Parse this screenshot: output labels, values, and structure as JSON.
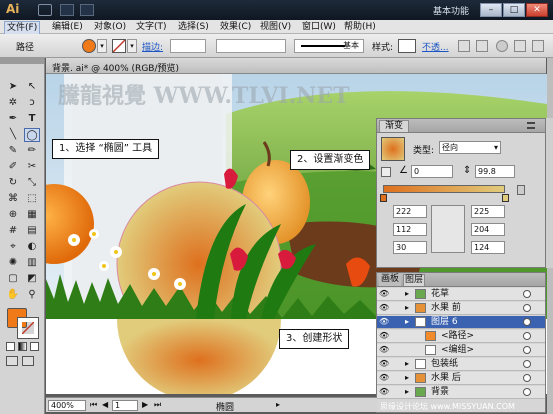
{
  "titlebar": {
    "app_logo": "Ai",
    "workspace": "基本功能",
    "buttons": [
      "–",
      "□",
      "✕"
    ]
  },
  "menubar": {
    "items": [
      "文件(F)",
      "编辑(E)",
      "对象(O)",
      "文字(T)",
      "选择(S)",
      "效果(C)",
      "视图(V)",
      "窗口(W)",
      "帮助(H)"
    ]
  },
  "controlbar": {
    "path_label": "路径",
    "stroke_label": "描边:",
    "stroke_style": "基本",
    "style_label": "样式:",
    "opacity_link": "不透...",
    "fill_color": "#f07a18",
    "stroke_color": "#c0392b"
  },
  "document": {
    "tab_title": "背景. ai* @ 400% (RGB/预览)",
    "watermark": "騰龍視覺 WWW.TLVI.NET"
  },
  "callouts": {
    "step1": "1、选择 “椭圆” 工具",
    "step2": "2、设置渐变色",
    "step3": "3、创建形状"
  },
  "gradient_panel": {
    "tab": "渐变",
    "type_label": "类型:",
    "type_value": "径向",
    "angle_value": "0",
    "scale_value": "99.8",
    "left_rgb": [
      "222",
      "112",
      "30"
    ],
    "right_rgb": [
      "225",
      "204",
      "124"
    ],
    "start_color": "#de701e",
    "end_color": "#e1cc7c"
  },
  "layers_panel": {
    "tabs": [
      "画板",
      "图层"
    ],
    "rows": [
      {
        "name": "花草",
        "indent": 0,
        "selected": false,
        "thumb": "#6aa84f"
      },
      {
        "name": "水果 前",
        "indent": 0,
        "selected": false,
        "thumb": "#e69138"
      },
      {
        "name": "图层 6",
        "indent": 0,
        "selected": true,
        "thumb": "#ffffff"
      },
      {
        "name": "<路径>",
        "indent": 1,
        "selected": false,
        "thumb": "#f08a2a"
      },
      {
        "name": "<编组>",
        "indent": 1,
        "selected": false,
        "thumb": "#ffffff"
      },
      {
        "name": "包装纸",
        "indent": 0,
        "selected": false,
        "thumb": "#ffffff"
      },
      {
        "name": "水果 后",
        "indent": 0,
        "selected": false,
        "thumb": "#e69138"
      },
      {
        "name": "背景",
        "indent": 0,
        "selected": false,
        "thumb": "#6aa84f"
      }
    ]
  },
  "statusbar": {
    "zoom": "400%",
    "page": "1",
    "tool_name": "椭圆"
  },
  "site_watermark": "思缘设计论坛 www.MISSYUAN.COM"
}
